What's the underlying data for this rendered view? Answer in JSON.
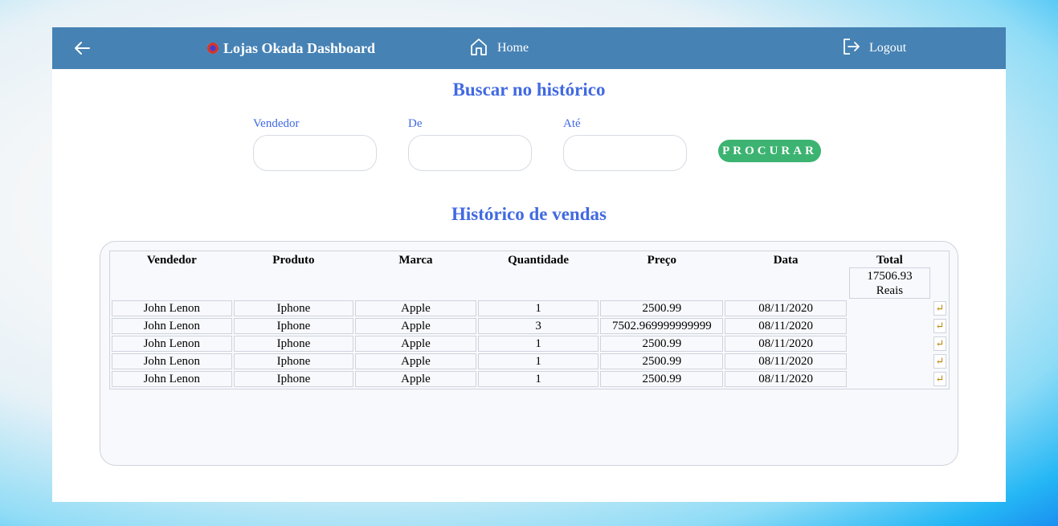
{
  "header": {
    "title": "Lojas Okada Dashboard",
    "home_label": "Home",
    "logout_label": "Logout",
    "bg_color": "#4682b4"
  },
  "search": {
    "title": "Buscar no histórico",
    "fields": [
      {
        "label": "Vendedor",
        "value": ""
      },
      {
        "label": "De",
        "value": ""
      },
      {
        "label": "Até",
        "value": ""
      }
    ],
    "button_label": "PROCURAR",
    "button_color": "#3cb371"
  },
  "history": {
    "title": "Histórico de vendas",
    "columns": [
      "Vendedor",
      "Produto",
      "Marca",
      "Quantidade",
      "Preço",
      "Data",
      "Total"
    ],
    "total_value": "17506.93",
    "total_unit": "Reais",
    "rows": [
      {
        "vendedor": "John Lenon",
        "produto": "Iphone",
        "marca": "Apple",
        "quantidade": "1",
        "preco": "2500.99",
        "data": "08/11/2020"
      },
      {
        "vendedor": "John Lenon",
        "produto": "Iphone",
        "marca": "Apple",
        "quantidade": "3",
        "preco": "7502.969999999999",
        "data": "08/11/2020"
      },
      {
        "vendedor": "John Lenon",
        "produto": "Iphone",
        "marca": "Apple",
        "quantidade": "1",
        "preco": "2500.99",
        "data": "08/11/2020"
      },
      {
        "vendedor": "John Lenon",
        "produto": "Iphone",
        "marca": "Apple",
        "quantidade": "1",
        "preco": "2500.99",
        "data": "08/11/2020"
      },
      {
        "vendedor": "John Lenon",
        "produto": "Iphone",
        "marca": "Apple",
        "quantidade": "1",
        "preco": "2500.99",
        "data": "08/11/2020"
      }
    ],
    "row_action_icon": "return-icon"
  },
  "colors": {
    "accent": "#4169e1",
    "success": "#3cb371"
  }
}
